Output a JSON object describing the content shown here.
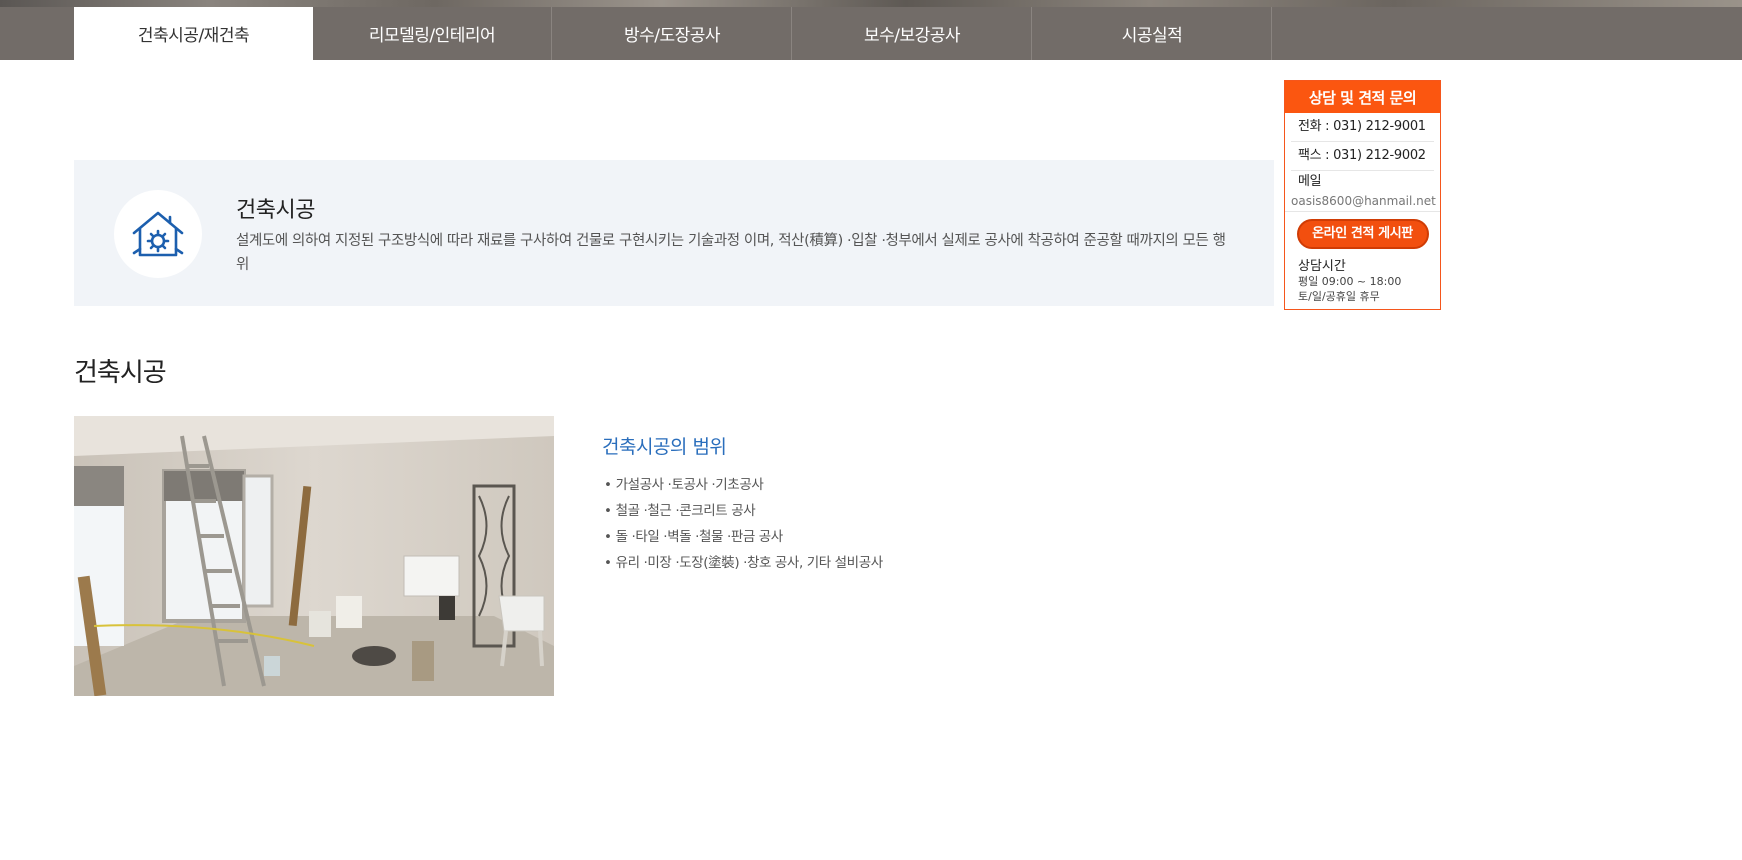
{
  "nav": {
    "tabs": [
      {
        "label": "건축시공/재건축",
        "active": true
      },
      {
        "label": "리모델링/인테리어",
        "active": false
      },
      {
        "label": "방수/도장공사",
        "active": false
      },
      {
        "label": "보수/보강공사",
        "active": false
      },
      {
        "label": "시공실적",
        "active": false
      }
    ]
  },
  "intro": {
    "icon": "house-gear-icon",
    "title": "건축시공",
    "description": "설계도에 의하여 지정된 구조방식에 따라 재료를 구사하여 건물로 구현시키는 기술과정 이며, 적산(積算) ·입찰 ·청부에서 실제로 공사에 착공하여 준공할 때까지의 모든 행위"
  },
  "section": {
    "title": "건축시공",
    "scope_title": "건축시공의 범위",
    "scope_items": [
      "가설공사 ·토공사 ·기초공사",
      "철골 ·철근 ·콘크리트 공사",
      "돌 ·타일 ·벽돌 ·철물 ·판금 공사",
      "유리 ·미장 ·도장(塗裝) ·창호 공사, 기타 설비공사"
    ]
  },
  "consult": {
    "title": "상담 및 견적 문의",
    "phone": "전화 : 031) 212-9001",
    "fax": "팩스 : 031) 212-9002",
    "mail_label": "메일",
    "mail": "oasis8600@hanmail.net",
    "online_button": "온라인 견적 게시판",
    "hours_title": "상담시간",
    "hours_weekday": "평일 09:00 ~ 18:00",
    "hours_holiday": "토/일/공휴일 휴무"
  },
  "colors": {
    "tabbar": "#726c68",
    "accent": "#fb5610",
    "scope_title": "#2a6ebc",
    "intro_bg": "#f1f4f8",
    "icon_blue": "#1c5fae"
  }
}
